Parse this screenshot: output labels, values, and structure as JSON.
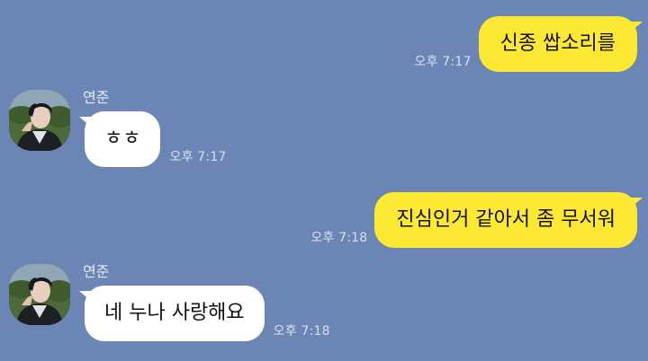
{
  "chat": {
    "messages": [
      {
        "direction": "out",
        "text": "신종 쌉소리를",
        "time": "오후 7:17"
      },
      {
        "direction": "in",
        "sender": "연준",
        "text": "ㅎㅎ",
        "time": "오후 7:17"
      },
      {
        "direction": "out",
        "text": "진심인거 같아서 좀 무서워",
        "time": "오후 7:18"
      },
      {
        "direction": "in",
        "sender": "연준",
        "text": "네 누나 사랑해요",
        "time": "오후 7:18"
      }
    ]
  },
  "colors": {
    "background": "#6b86b5",
    "outgoing_bubble": "#fde933",
    "incoming_bubble": "#ffffff"
  },
  "icons": {
    "avatar": "profile-photo-avatar"
  }
}
